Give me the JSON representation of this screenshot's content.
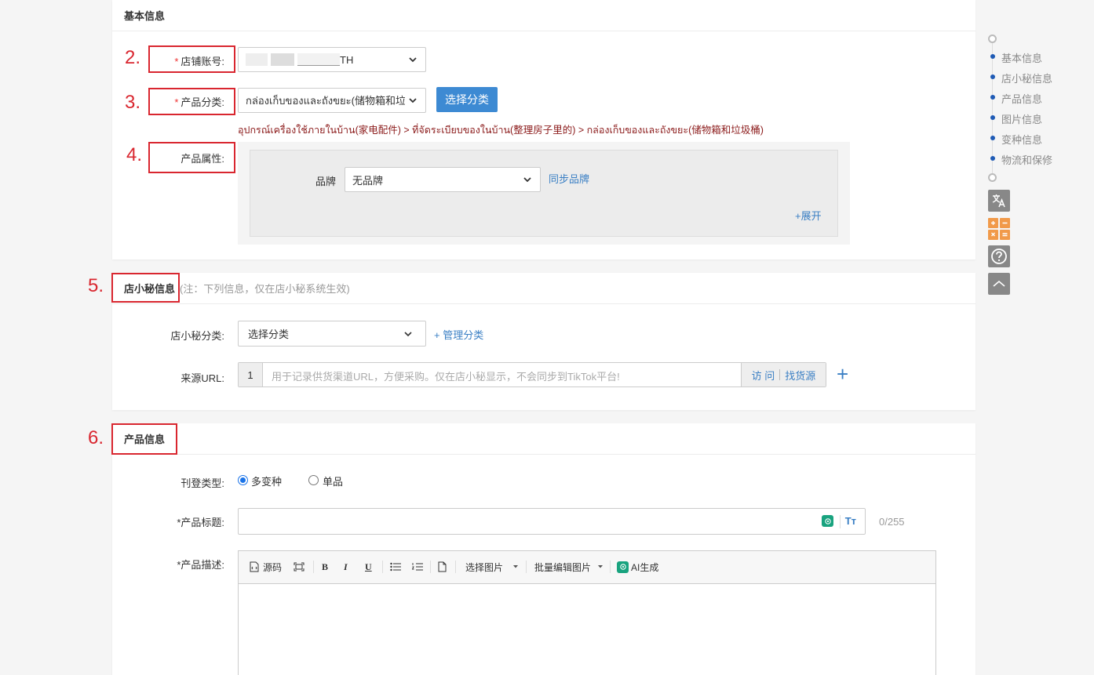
{
  "basic": {
    "header": "基本信息",
    "shop_label": "店铺账号:",
    "shop_value": "TH",
    "category_label": "产品分类:",
    "category_value": "กล่องเก็บของและถังขยะ(储物箱和垃圾",
    "choose_category_btn": "选择分类",
    "category_path": "อุปกรณ์เครื่องใช้ภายในบ้าน(家电配件) > ที่จัดระเบียบของในบ้าน(整理房子里的) > กล่องเก็บของและถังขยะ(储物箱和垃圾桶)",
    "attr_label": "产品属性:",
    "brand_label": "品牌",
    "brand_value": "无品牌",
    "sync_brand": "同步品牌",
    "expand": "+展开"
  },
  "secret": {
    "header": "店小秘信息",
    "note": "(注：下列信息，仅在店小秘系统生效)",
    "cat_label": "店小秘分类:",
    "cat_value": "选择分类",
    "manage_cat": "+ 管理分类",
    "url_label": "来源URL:",
    "url_index": "1",
    "url_placeholder": "用于记录供货渠道URL，方便采购。仅在店小秘显示，不会同步到TikTok平台!",
    "visit": "访 问",
    "find_source": "找货源",
    "add_icon": "+"
  },
  "product": {
    "header": "产品信息",
    "listing_label": "刊登类型:",
    "opt_multi": "多变种",
    "opt_single": "单品",
    "title_label": "*产品标题:",
    "title_count": "0/255",
    "desc_label": "*产品描述:",
    "tb_source": "源码",
    "tb_bold": "B",
    "tb_italic": "I",
    "tb_underline": "U",
    "tb_pick_image": "选择图片",
    "tb_batch_image": "批量编辑图片",
    "tb_ai": "AI生成",
    "tt_icon": "Tт"
  },
  "annotations": [
    "2.",
    "3.",
    "4.",
    "5.",
    "6."
  ],
  "nav": {
    "items": [
      "基本信息",
      "店小秘信息",
      "产品信息",
      "图片信息",
      "变种信息",
      "物流和保修"
    ]
  },
  "colors": {
    "accent": "#3d8ad3",
    "annotation": "#d9262f",
    "nav_dot": "#1f5bb5"
  }
}
